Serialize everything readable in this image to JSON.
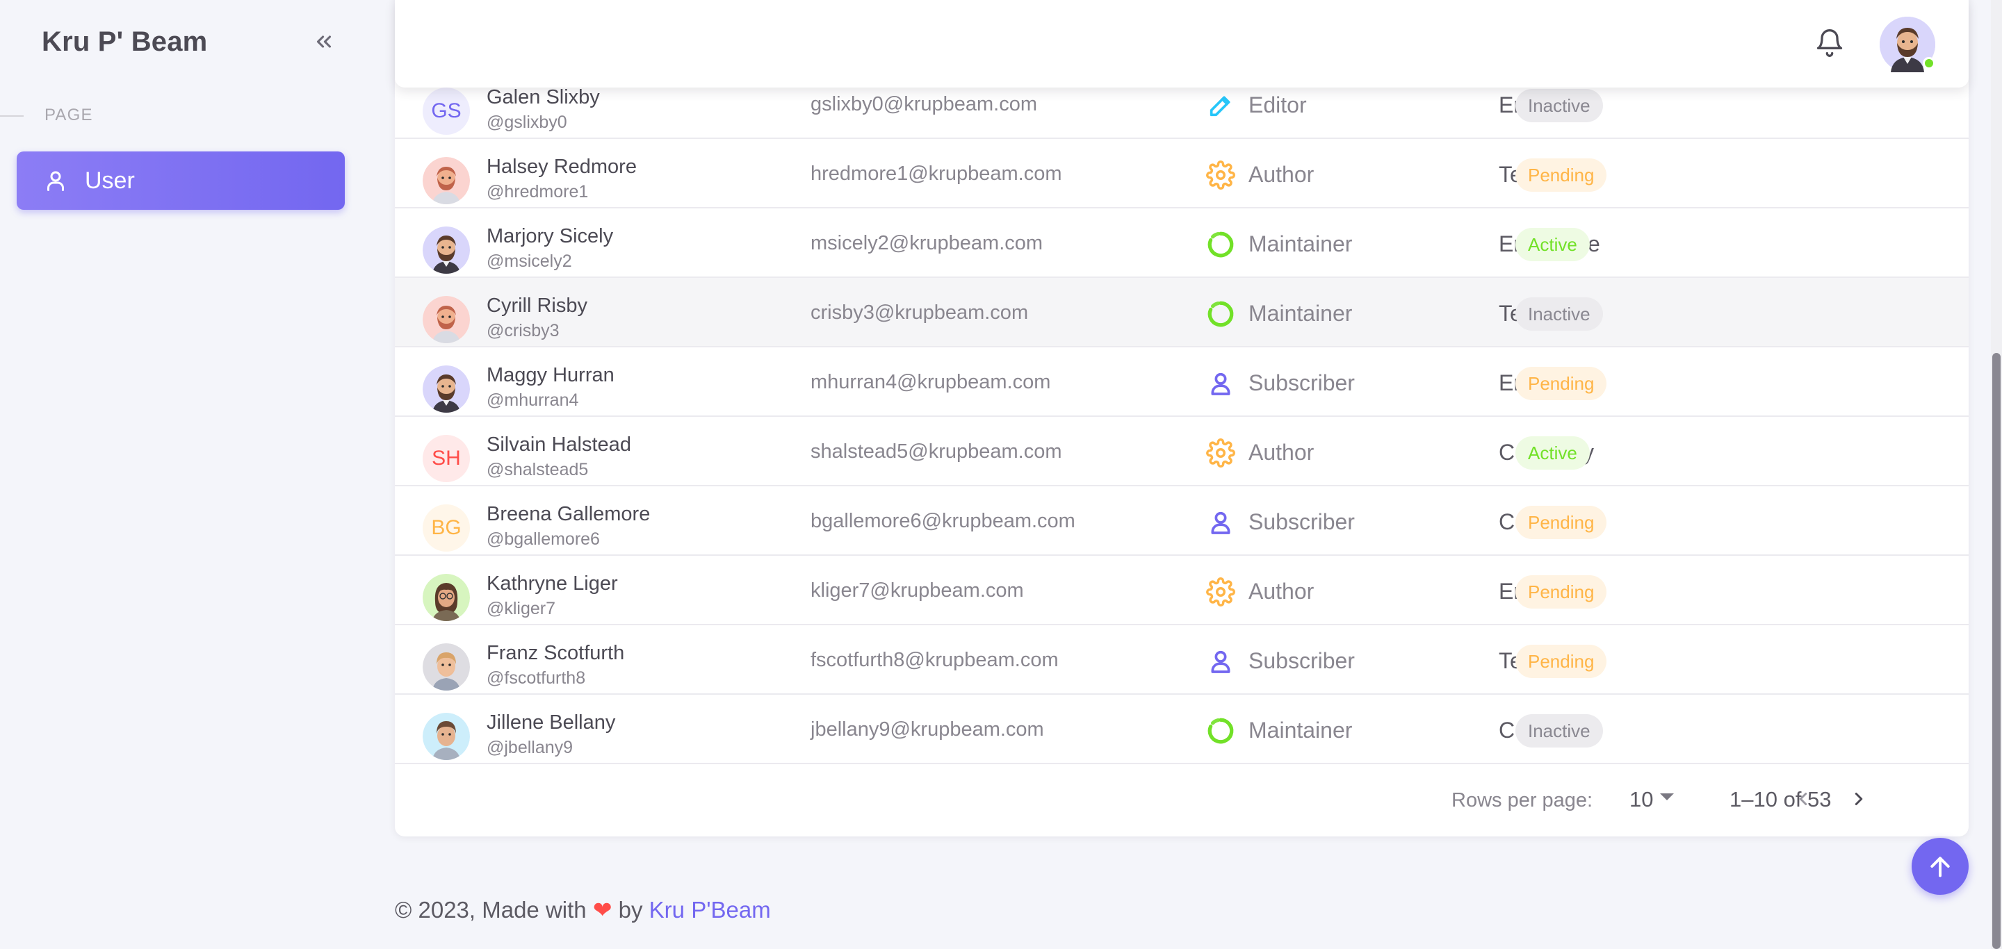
{
  "app": {
    "brand": "Kru P' Beam"
  },
  "sidebar": {
    "section_label": "PAGE",
    "items": [
      {
        "label": "User",
        "icon": "user-icon",
        "active": true
      }
    ]
  },
  "colors": {
    "primary": "#7367f0",
    "success": "#72e128",
    "warning": "#ffb547",
    "info": "#26c6f9",
    "error": "#ff4d49",
    "secondary": "#8a8891"
  },
  "users": [
    {
      "name": "Galen Slixby",
      "handle": "@gslixby0",
      "email": "gslixby0@krupbeam.com",
      "role": "Editor",
      "role_icon": "pencil-icon",
      "plan": "Enterprise",
      "status": "Inactive",
      "avatar_initials": "GS",
      "avatar_color": "#7367f0"
    },
    {
      "name": "Halsey Redmore",
      "handle": "@hredmore1",
      "email": "hredmore1@krupbeam.com",
      "role": "Author",
      "role_icon": "gear-icon",
      "plan": "Team",
      "status": "Pending",
      "avatar_image": "redhead-man-avatar"
    },
    {
      "name": "Marjory Sicely",
      "handle": "@msicely2",
      "email": "msicely2@krupbeam.com",
      "role": "Maintainer",
      "role_icon": "chart-donut-icon",
      "plan": "Enterprise",
      "status": "Active",
      "avatar_image": "bearded-man-avatar"
    },
    {
      "name": "Cyrill Risby",
      "handle": "@crisby3",
      "email": "crisby3@krupbeam.com",
      "role": "Maintainer",
      "role_icon": "chart-donut-icon",
      "plan": "Team",
      "status": "Inactive",
      "avatar_image": "redhead-man-avatar"
    },
    {
      "name": "Maggy Hurran",
      "handle": "@mhurran4",
      "email": "mhurran4@krupbeam.com",
      "role": "Subscriber",
      "role_icon": "user-outline-icon",
      "plan": "Enterprise",
      "status": "Pending",
      "avatar_image": "bearded-man-avatar"
    },
    {
      "name": "Silvain Halstead",
      "handle": "@shalstead5",
      "email": "shalstead5@krupbeam.com",
      "role": "Author",
      "role_icon": "gear-icon",
      "plan": "Company",
      "status": "Active",
      "avatar_initials": "SH",
      "avatar_color": "#ff4d49"
    },
    {
      "name": "Breena Gallemore",
      "handle": "@bgallemore6",
      "email": "bgallemore6@krupbeam.com",
      "role": "Subscriber",
      "role_icon": "user-outline-icon",
      "plan": "Company",
      "status": "Pending",
      "avatar_initials": "BG",
      "avatar_color": "#ffb547"
    },
    {
      "name": "Kathryne Liger",
      "handle": "@kliger7",
      "email": "kliger7@krupbeam.com",
      "role": "Author",
      "role_icon": "gear-icon",
      "plan": "Enterprise",
      "status": "Pending",
      "avatar_image": "woman-glasses-avatar"
    },
    {
      "name": "Franz Scotfurth",
      "handle": "@fscotfurth8",
      "email": "fscotfurth8@krupbeam.com",
      "role": "Subscriber",
      "role_icon": "user-outline-icon",
      "plan": "Team",
      "status": "Pending",
      "avatar_image": "blond-man-avatar"
    },
    {
      "name": "Jillene Bellany",
      "handle": "@jbellany9",
      "email": "jbellany9@krupbeam.com",
      "role": "Maintainer",
      "role_icon": "chart-donut-icon",
      "plan": "Company",
      "status": "Inactive",
      "avatar_image": "brunette-woman-avatar"
    }
  ],
  "pagination": {
    "rows_per_page_label": "Rows per page:",
    "rows_per_page": "10",
    "range": "1–10 of 53"
  },
  "footer": {
    "prefix": "© 2023, Made with",
    "heart": "❤",
    "by": "by",
    "link": "Kru P'Beam"
  }
}
